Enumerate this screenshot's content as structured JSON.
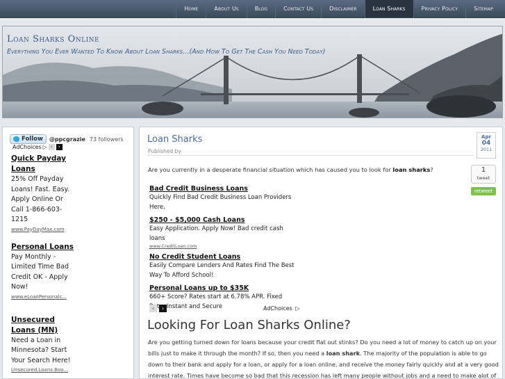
{
  "nav": {
    "items": [
      "Home",
      "About Us",
      "Blog",
      "Contact Us",
      "Disclaimer",
      "Loan Sharks",
      "Privacy Policy",
      "Sitemap"
    ],
    "active": "Loan Sharks"
  },
  "header": {
    "title": "Loan Sharks Online",
    "tagline": "Everything You Ever Wanted To Know About Loan Sharks…(And How To Get The Cash You Need Today)"
  },
  "sidebar": {
    "follow_label": "Follow",
    "handle": "@ppcgrazie",
    "followers": "73 followers",
    "adchoices": "AdChoices",
    "ads": [
      {
        "title": "Quick Payday Loans",
        "body": "25% Off Payday Loans! Fast. Easy. Apply Online Or Call 1-866-603-1215",
        "url": "www.PayDayMax.com"
      },
      {
        "title": "Personal Loans",
        "body": "Pay Monthly - Limited Time Bad Credit OK - Apply Now!",
        "url": "www.eLoanPersonalc..."
      },
      {
        "title": "Unsecured Loans (MN)",
        "body": "Need a Loan in Minnesota? Start Your Search Here!",
        "url": "Unsecured.Loans.Boo..."
      }
    ]
  },
  "post": {
    "title": "Loan Sharks",
    "published": "Published by",
    "intro_pre": "Are you currently in a desperate financial situation which has caused you to look for ",
    "intro_bold": "loan sharks",
    "intro_post": "?",
    "ads": [
      {
        "title": "Bad Credit Business Loans",
        "body": "Quickly Find Bad Credit Business Loan Providers Here.",
        "url": ""
      },
      {
        "title": "$250 - $5,000 Cash Loans",
        "body": "Easy Application. Apply Now! Bad credit cash loans",
        "url": "www.CreditLoan.com"
      },
      {
        "title": "No Credit Student Loans",
        "body": "Easily Compare Lenders And Rates Find The Best Way To Afford School!",
        "url": ""
      },
      {
        "title": "Personal Loans up to $35K",
        "body": "660+ Score? Rates start at 6.78% APR. Fixed Rate. Instant and Secure",
        "url": ""
      }
    ],
    "adchoices": "AdChoices",
    "heading": "Looking For Loan Sharks Online?",
    "body_1": "Are you getting turned down for loans because your credit flat out stinks? Do you need a lot of money to catch up on your bills just to make it through the month? If so, then you need a ",
    "body_bold": "loan shark",
    "body_2": ". The majority of the population is able to go down to their bank and apply for a loan, or apply for a loan online, and receive the money fairly quickly and at a very good interest rate. Times have become so bad that this recession has left many people without jobs and a need to make alot of money to cover their bills and expenses. In fact, you may even need money to start a business."
  },
  "date": {
    "month": "Apr",
    "day": "04",
    "year": "2011"
  },
  "share": {
    "count": "1",
    "tweet_label": "tweet",
    "retweet_label": "retweet"
  }
}
